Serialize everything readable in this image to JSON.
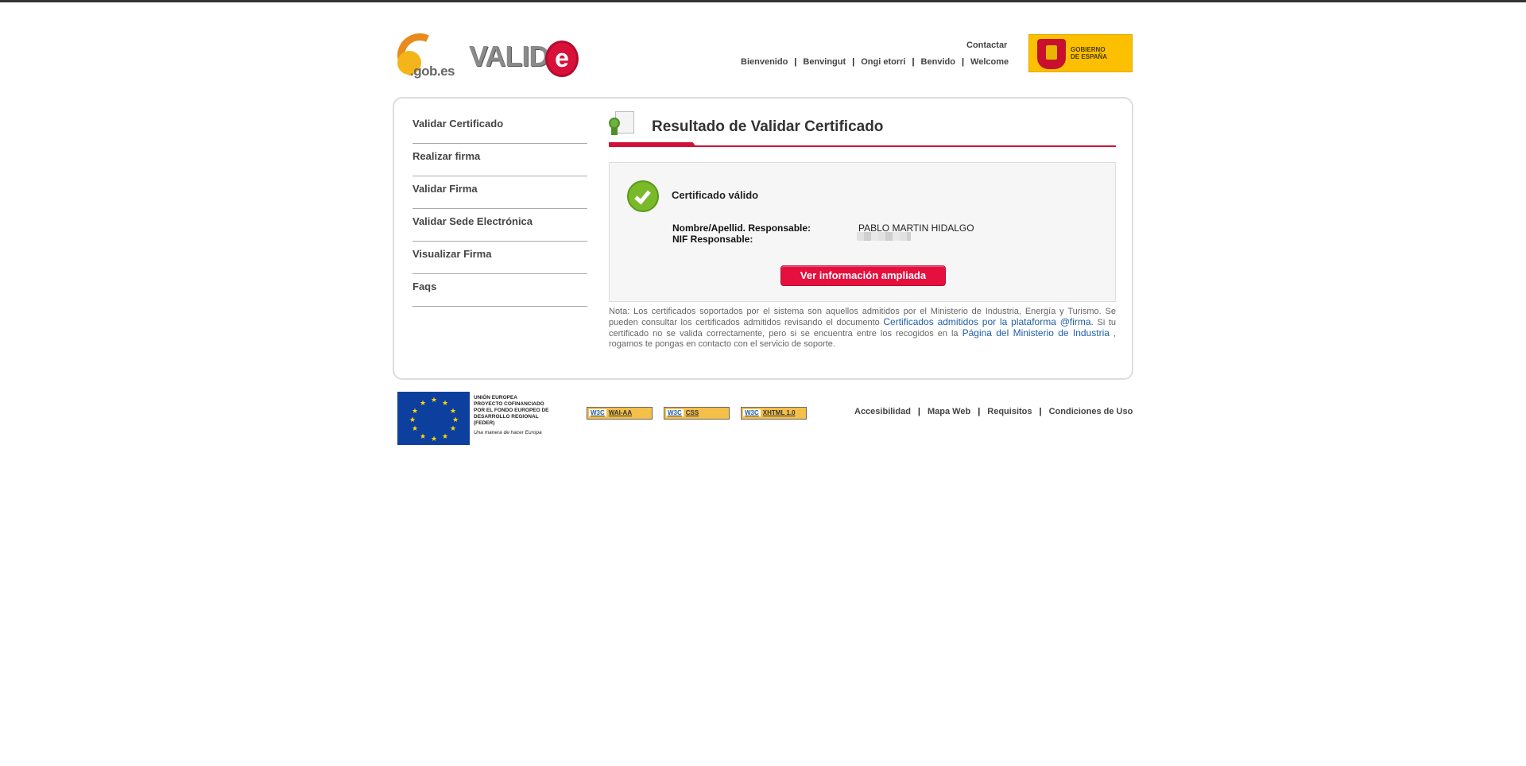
{
  "header": {
    "gob_logo_text": ".gob.es",
    "valide_logo_text": "VALID",
    "valide_logo_e": "e",
    "contact_label": "Contactar",
    "languages": [
      "Bienvenido",
      "Benvingut",
      "Ongi etorri",
      "Benvido",
      "Welcome"
    ],
    "separator": "|",
    "gobierno_label_1": "GOBIERNO",
    "gobierno_label_2": "DE ESPAÑA"
  },
  "sidebar": {
    "items": [
      {
        "label": "Validar Certificado"
      },
      {
        "label": "Realizar firma"
      },
      {
        "label": "Validar Firma"
      },
      {
        "label": "Validar Sede Electrónica"
      },
      {
        "label": "Visualizar Firma"
      },
      {
        "label": "Faqs"
      }
    ]
  },
  "main": {
    "title": "Resultado de Validar Certificado",
    "status": "Certificado válido",
    "fields": {
      "name_label": "Nombre/Apellid. Responsable:",
      "name_value": "PABLO MARTIN HIDALGO",
      "nif_label": "NIF Responsable:"
    },
    "more_button": "Ver información ampliada",
    "note": {
      "part1": "Nota: Los certificados soportados por el sistema son aquellos admitidos por el Ministerio de Industria, Energía y Turismo. Se pueden consultar los certificados admitidos revisando el documento ",
      "link1": "Certificados admitidos por la plataforma @firma.",
      "part2": " Si tu certificado no se valida correctamente, pero si se encuentra entre los recogidos en la ",
      "link2": "Página del Ministerio de Industria",
      "part3": " , rogamos te pongas en contacto con el servicio de soporte."
    }
  },
  "footer": {
    "eu_title": "UNIÓN EUROPEA",
    "eu_line1": "PROYECTO COFINANCIADO",
    "eu_line2": "POR EL FONDO EUROPEO DE",
    "eu_line3": "DESARROLLO REGIONAL",
    "eu_line4": "(FEDER)",
    "eu_tagline": "Una manera de hacer Europa",
    "badges": [
      {
        "w3": "W3C",
        "label": "WAI-AA"
      },
      {
        "w3": "W3C",
        "label": "CSS"
      },
      {
        "w3": "W3C",
        "label": "XHTML 1.0"
      }
    ],
    "links": [
      "Accesibilidad",
      "Mapa Web",
      "Requisitos",
      "Condiciones de Uso"
    ],
    "separator": "|"
  }
}
